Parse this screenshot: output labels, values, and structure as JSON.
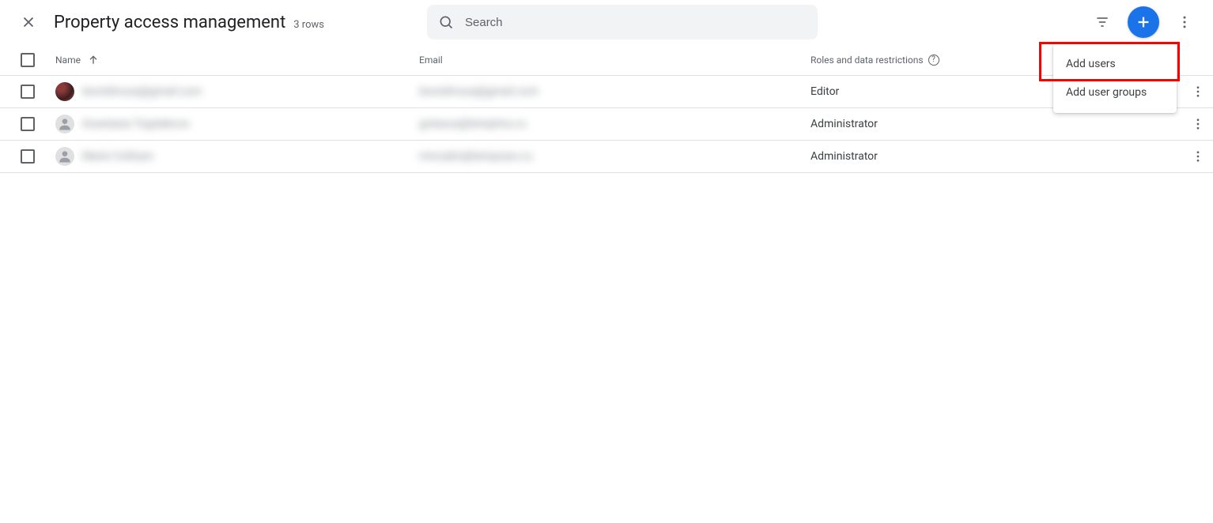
{
  "header": {
    "title": "Property access management",
    "row_count_label": "3 rows",
    "search_placeholder": "Search"
  },
  "columns": {
    "name": "Name",
    "email": "Email",
    "roles": "Roles and data restrictions"
  },
  "rows": [
    {
      "name_blur": "leonidmusa@gmail.com",
      "email_blur": "leonidmusa@gmail.com",
      "role": "Editor",
      "avatar_type": "custom"
    },
    {
      "name_blur": "Anastasia Tsyplakova",
      "email_blur": "gotasus@temptmu.ru",
      "role": "Administrator",
      "avatar_type": "person"
    },
    {
      "name_blur": "Marie Colitsen",
      "email_blur": "mmzabri@tempsaru.ru",
      "role": "Administrator",
      "avatar_type": "person"
    }
  ],
  "dropdown": {
    "add_users": "Add users",
    "add_user_groups": "Add user groups"
  }
}
